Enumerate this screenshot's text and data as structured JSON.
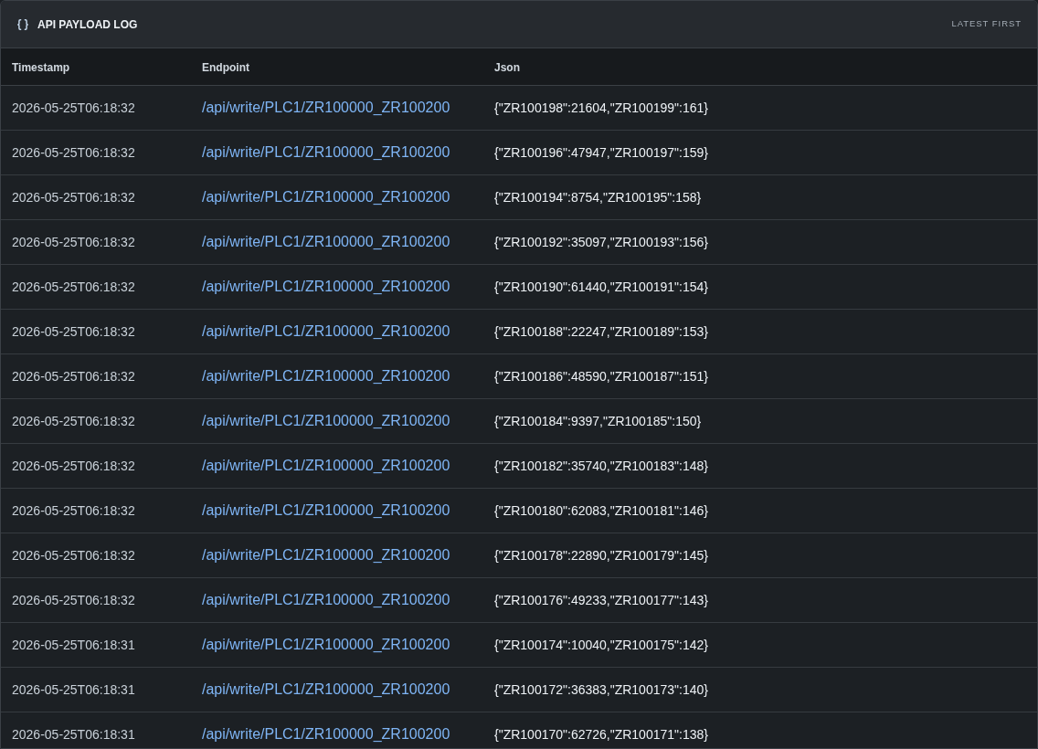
{
  "panel": {
    "title": "API PAYLOAD LOG",
    "sort_label": "LATEST FIRST"
  },
  "table": {
    "columns": [
      "Timestamp",
      "Endpoint",
      "Json"
    ],
    "rows": [
      {
        "timestamp": "2026-05-25T06:18:32",
        "endpoint": "/api/write/PLC1/ZR100000_ZR100200",
        "json": "{\"ZR100198\":21604,\"ZR100199\":161}"
      },
      {
        "timestamp": "2026-05-25T06:18:32",
        "endpoint": "/api/write/PLC1/ZR100000_ZR100200",
        "json": "{\"ZR100196\":47947,\"ZR100197\":159}"
      },
      {
        "timestamp": "2026-05-25T06:18:32",
        "endpoint": "/api/write/PLC1/ZR100000_ZR100200",
        "json": "{\"ZR100194\":8754,\"ZR100195\":158}"
      },
      {
        "timestamp": "2026-05-25T06:18:32",
        "endpoint": "/api/write/PLC1/ZR100000_ZR100200",
        "json": "{\"ZR100192\":35097,\"ZR100193\":156}"
      },
      {
        "timestamp": "2026-05-25T06:18:32",
        "endpoint": "/api/write/PLC1/ZR100000_ZR100200",
        "json": "{\"ZR100190\":61440,\"ZR100191\":154}"
      },
      {
        "timestamp": "2026-05-25T06:18:32",
        "endpoint": "/api/write/PLC1/ZR100000_ZR100200",
        "json": "{\"ZR100188\":22247,\"ZR100189\":153}"
      },
      {
        "timestamp": "2026-05-25T06:18:32",
        "endpoint": "/api/write/PLC1/ZR100000_ZR100200",
        "json": "{\"ZR100186\":48590,\"ZR100187\":151}"
      },
      {
        "timestamp": "2026-05-25T06:18:32",
        "endpoint": "/api/write/PLC1/ZR100000_ZR100200",
        "json": "{\"ZR100184\":9397,\"ZR100185\":150}"
      },
      {
        "timestamp": "2026-05-25T06:18:32",
        "endpoint": "/api/write/PLC1/ZR100000_ZR100200",
        "json": "{\"ZR100182\":35740,\"ZR100183\":148}"
      },
      {
        "timestamp": "2026-05-25T06:18:32",
        "endpoint": "/api/write/PLC1/ZR100000_ZR100200",
        "json": "{\"ZR100180\":62083,\"ZR100181\":146}"
      },
      {
        "timestamp": "2026-05-25T06:18:32",
        "endpoint": "/api/write/PLC1/ZR100000_ZR100200",
        "json": "{\"ZR100178\":22890,\"ZR100179\":145}"
      },
      {
        "timestamp": "2026-05-25T06:18:32",
        "endpoint": "/api/write/PLC1/ZR100000_ZR100200",
        "json": "{\"ZR100176\":49233,\"ZR100177\":143}"
      },
      {
        "timestamp": "2026-05-25T06:18:31",
        "endpoint": "/api/write/PLC1/ZR100000_ZR100200",
        "json": "{\"ZR100174\":10040,\"ZR100175\":142}"
      },
      {
        "timestamp": "2026-05-25T06:18:31",
        "endpoint": "/api/write/PLC1/ZR100000_ZR100200",
        "json": "{\"ZR100172\":36383,\"ZR100173\":140}"
      },
      {
        "timestamp": "2026-05-25T06:18:31",
        "endpoint": "/api/write/PLC1/ZR100000_ZR100200",
        "json": "{\"ZR100170\":62726,\"ZR100171\":138}"
      }
    ]
  }
}
